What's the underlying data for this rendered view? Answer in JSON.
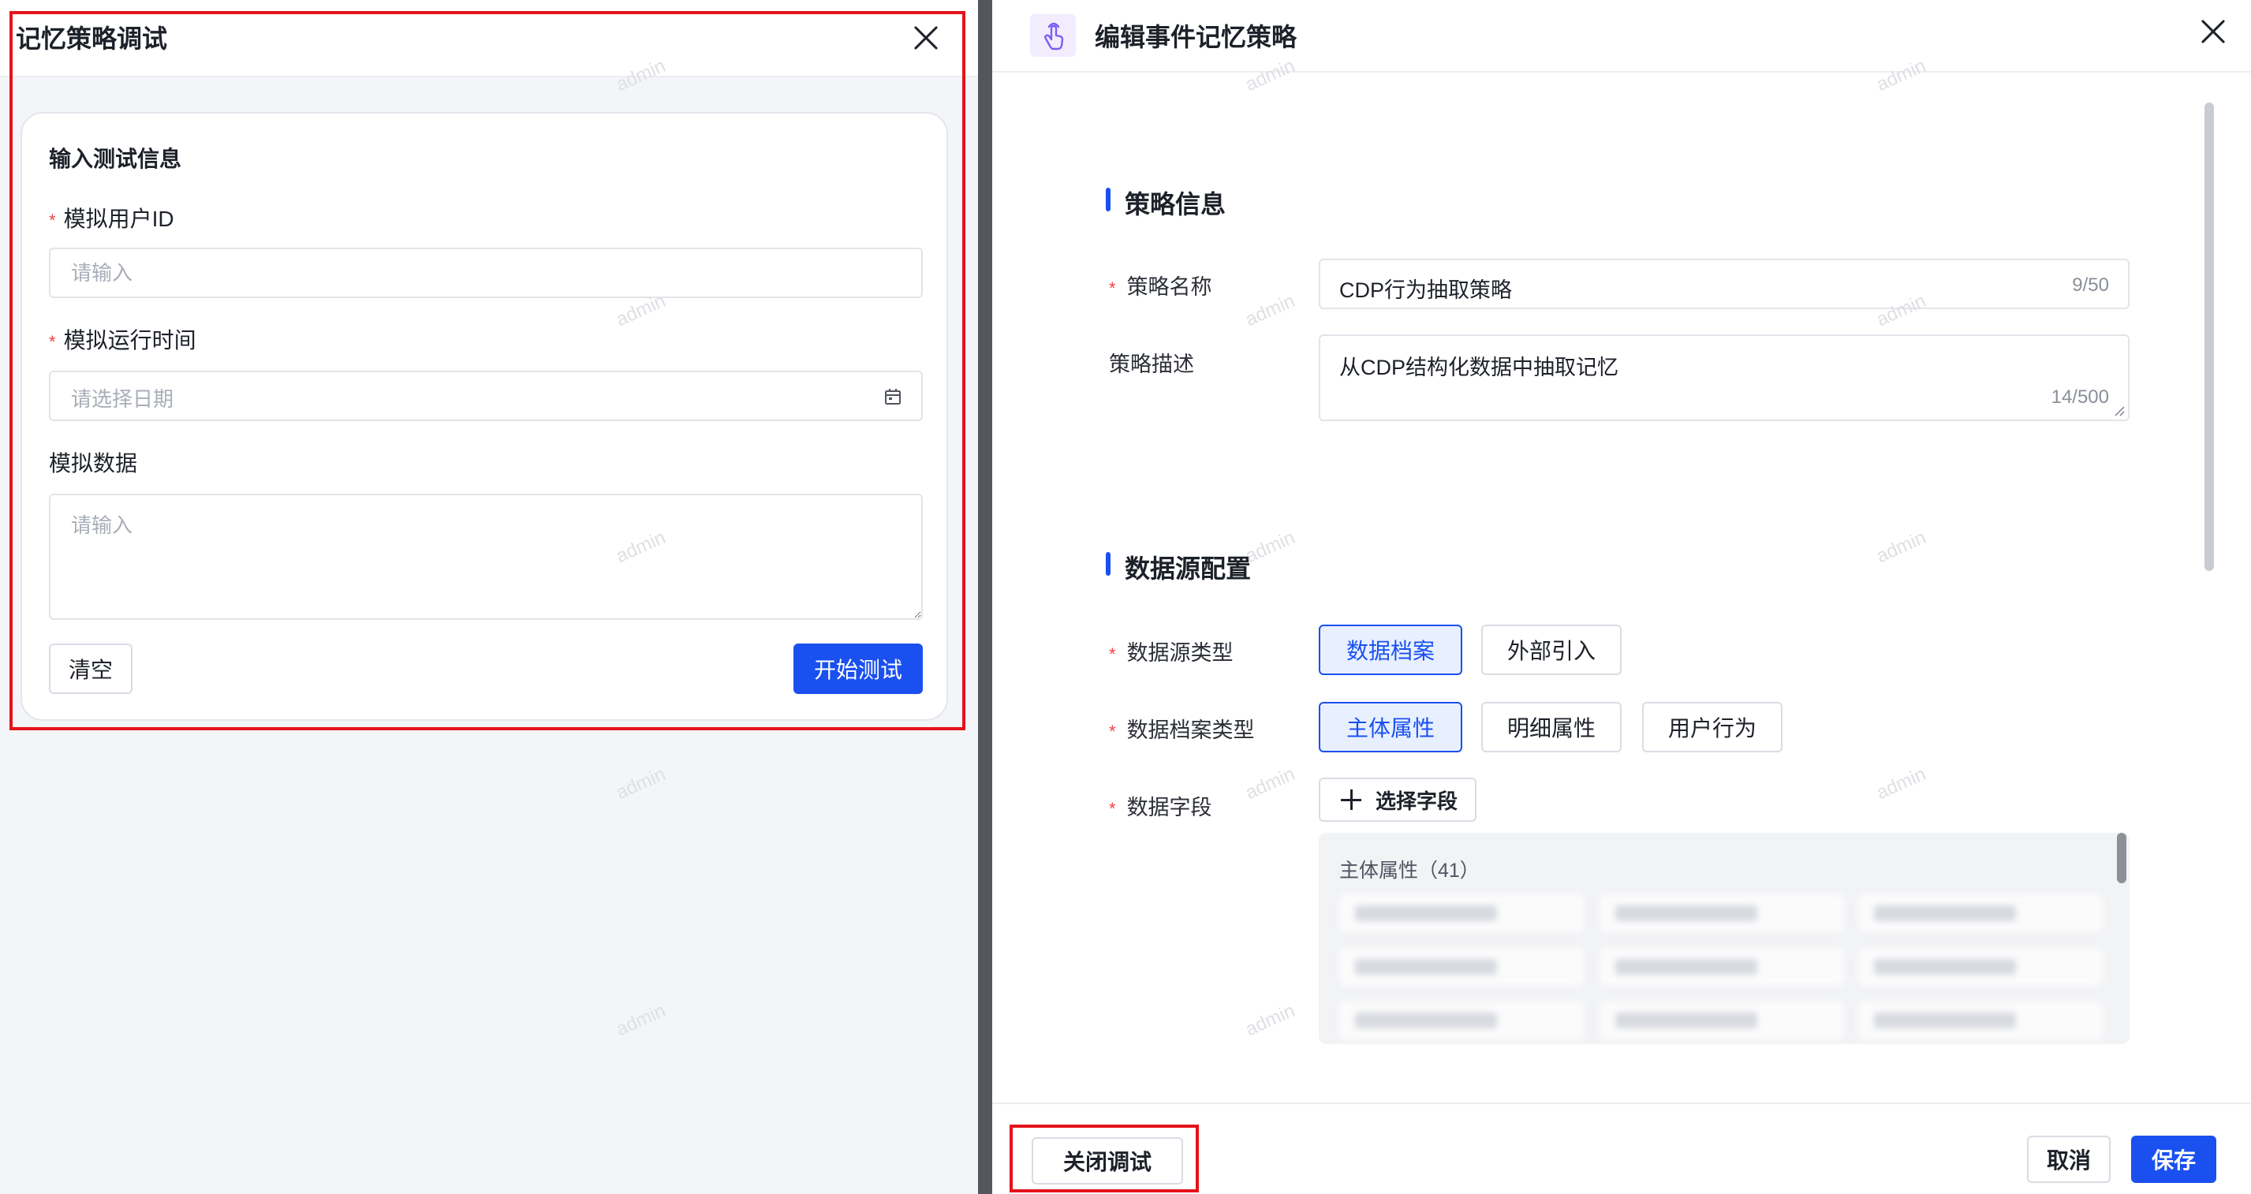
{
  "debug_panel": {
    "title": "记忆策略调试",
    "card_title": "输入测试信息",
    "user_id_label": "模拟用户ID",
    "user_id_placeholder": "请输入",
    "run_time_label": "模拟运行时间",
    "run_time_placeholder": "请选择日期",
    "mock_data_label": "模拟数据",
    "mock_data_placeholder": "请输入",
    "clear_label": "清空",
    "start_label": "开始测试"
  },
  "drawer": {
    "title": "编辑事件记忆策略",
    "section_strategy": "策略信息",
    "name_label": "策略名称",
    "name_value": "CDP行为抽取策略",
    "name_count": "9/50",
    "desc_label": "策略描述",
    "desc_value": "从CDP结构化数据中抽取记忆",
    "desc_count": "14/500",
    "section_datasource": "数据源配置",
    "source_type_label": "数据源类型",
    "source_types": [
      "数据档案",
      "外部引入"
    ],
    "archive_type_label": "数据档案类型",
    "archive_types": [
      "主体属性",
      "明细属性",
      "用户行为"
    ],
    "field_label": "数据字段",
    "select_field_label": "选择字段",
    "field_group_title": "主体属性（41）",
    "footer": {
      "close_debug_label": "关闭调试",
      "cancel_label": "取消",
      "save_label": "保存"
    }
  },
  "watermark_text": "admin",
  "colors": {
    "primary": "#1a50f0",
    "required": "#f53f3f",
    "highlight_frame": "#e5131b",
    "chip_active_bg": "#e8f0ff",
    "icon_bg": "#f2ecff"
  }
}
